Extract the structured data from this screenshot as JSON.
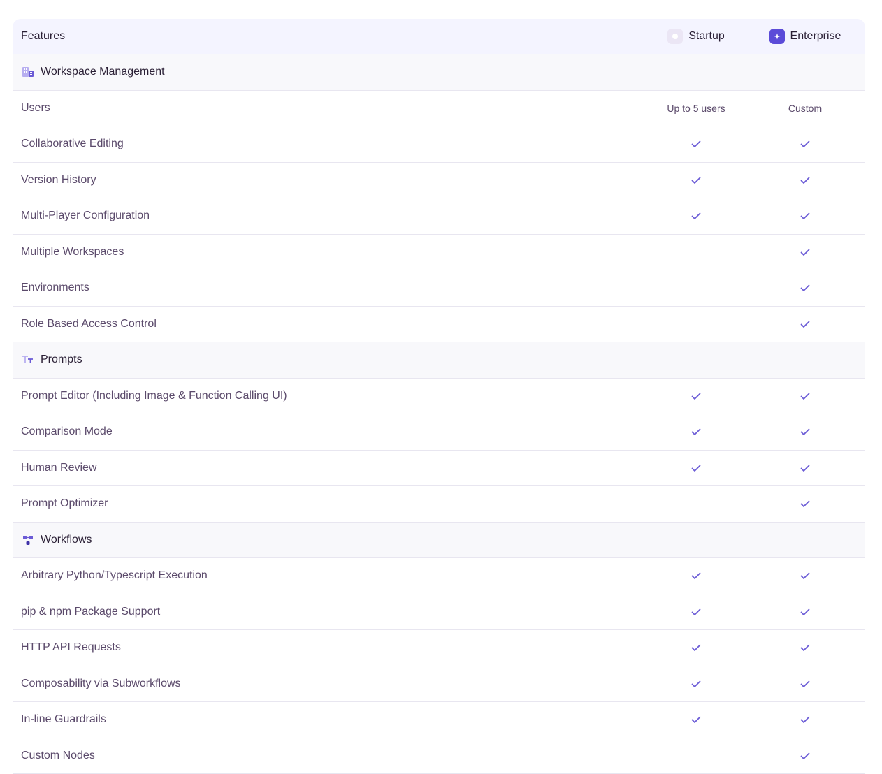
{
  "header": {
    "features_label": "Features",
    "startup_label": "Startup",
    "enterprise_label": "Enterprise"
  },
  "colors": {
    "accent": "#6b5bd6",
    "header_bg": "#f4f4ff",
    "section_bg": "#f8f8fb",
    "border": "#e8e6f0"
  },
  "rows": [
    {
      "kind": "section",
      "label": "Workspace Management",
      "icon": "building-icon"
    },
    {
      "kind": "feature",
      "label": "Users",
      "startup": "Up to 5 users",
      "enterprise": "Custom"
    },
    {
      "kind": "feature",
      "label": "Collaborative Editing",
      "startup": true,
      "enterprise": true
    },
    {
      "kind": "feature",
      "label": "Version History",
      "startup": true,
      "enterprise": true
    },
    {
      "kind": "feature",
      "label": "Multi-Player Configuration",
      "startup": true,
      "enterprise": true
    },
    {
      "kind": "feature",
      "label": "Multiple Workspaces",
      "startup": false,
      "enterprise": true
    },
    {
      "kind": "feature",
      "label": "Environments",
      "startup": false,
      "enterprise": true
    },
    {
      "kind": "feature",
      "label": "Role Based Access Control",
      "startup": false,
      "enterprise": true
    },
    {
      "kind": "section",
      "label": "Prompts",
      "icon": "text-size-icon"
    },
    {
      "kind": "feature",
      "label": "Prompt Editor (Including Image & Function Calling UI)",
      "startup": true,
      "enterprise": true
    },
    {
      "kind": "feature",
      "label": "Comparison Mode",
      "startup": true,
      "enterprise": true
    },
    {
      "kind": "feature",
      "label": "Human Review",
      "startup": true,
      "enterprise": true
    },
    {
      "kind": "feature",
      "label": "Prompt Optimizer",
      "startup": false,
      "enterprise": true
    },
    {
      "kind": "section",
      "label": "Workflows",
      "icon": "workflow-nodes-icon"
    },
    {
      "kind": "feature",
      "label": "Arbitrary Python/Typescript Execution",
      "startup": true,
      "enterprise": true
    },
    {
      "kind": "feature",
      "label": "pip & npm Package Support",
      "startup": true,
      "enterprise": true
    },
    {
      "kind": "feature",
      "label": "HTTP API Requests",
      "startup": true,
      "enterprise": true
    },
    {
      "kind": "feature",
      "label": "Composability via Subworkflows",
      "startup": true,
      "enterprise": true
    },
    {
      "kind": "feature",
      "label": "In-line Guardrails",
      "startup": true,
      "enterprise": true
    },
    {
      "kind": "feature",
      "label": "Custom Nodes",
      "startup": false,
      "enterprise": true
    }
  ]
}
